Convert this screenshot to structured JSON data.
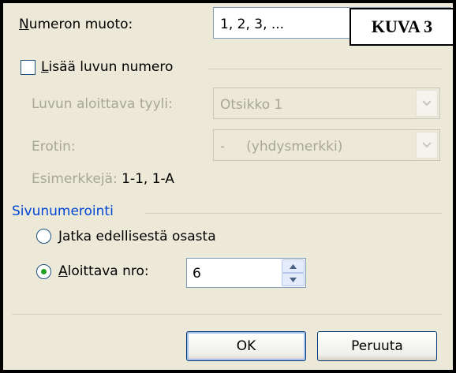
{
  "numbering_format": {
    "label_prefix": "N",
    "label_rest": "umeron muoto:",
    "value": "1, 2, 3, ..."
  },
  "badge": "KUVA 3",
  "include_chapter": {
    "label_prefix": "L",
    "label_rest": "isää luvun numero",
    "checked": false
  },
  "chapter_style": {
    "label": "Luvun aloittava tyyli:",
    "value": "Otsikko 1"
  },
  "separator": {
    "label": "Erotin:",
    "value": "-     (yhdysmerkki)"
  },
  "examples": {
    "label": "Esimerkkejä:",
    "value": "1-1, 1-A"
  },
  "page_numbering": {
    "group_label": "Sivunumerointi",
    "continue": {
      "label_prefix": "J",
      "label_rest": "atka edellisestä osasta",
      "selected": false
    },
    "start_at": {
      "label_prefix": "A",
      "label_rest": "loittava nro:",
      "selected": true,
      "value": "6"
    }
  },
  "buttons": {
    "ok": "OK",
    "cancel": "Peruuta"
  },
  "colors": {
    "group_label": "#0046D5",
    "disabled_text": "#A7A697",
    "dialog_bg": "#ECE9D8"
  },
  "icons": {
    "dropdown": "chevron-down-icon",
    "spin_up": "triangle-up-icon",
    "spin_down": "triangle-down-icon"
  }
}
